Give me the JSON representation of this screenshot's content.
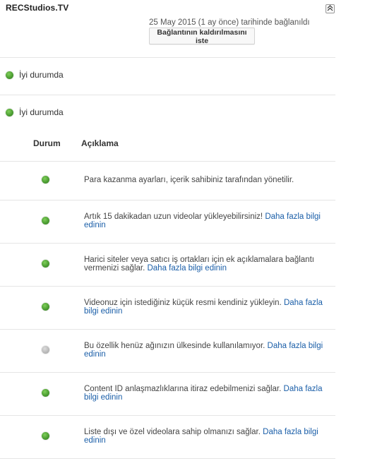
{
  "channel": {
    "name": "RECStudios.TV",
    "linked_text": "25 May 2015 (1 ay önce) tarihinde bağlanıldı",
    "unlink_button": "Bağlantının kaldırılmasını iste",
    "collapse_symbol": "⌃"
  },
  "status_summary": [
    {
      "label": "İyi durumda",
      "color": "#4d9e33"
    },
    {
      "label": "İyi durumda",
      "color": "#4d9e33"
    }
  ],
  "table": {
    "headers": {
      "status": "Durum",
      "description": "Açıklama"
    },
    "rows": [
      {
        "status": "green",
        "text": "Para kazanma ayarları, içerik sahibiniz tarafından yönetilir.",
        "link": ""
      },
      {
        "status": "green",
        "text": "Artık 15 dakikadan uzun videolar yükleyebilirsiniz! ",
        "link": "Daha fazla bilgi edinin"
      },
      {
        "status": "green",
        "text": "Harici siteler veya satıcı iş ortakları için ek açıklamalara bağlantı vermenizi sağlar. ",
        "link": "Daha fazla bilgi edinin"
      },
      {
        "status": "green",
        "text": "Videonuz için istediğiniz küçük resmi kendiniz yükleyin. ",
        "link": "Daha fazla bilgi edinin"
      },
      {
        "status": "gray",
        "text": "Bu özellik henüz ağınızın ülkesinde kullanılamıyor. ",
        "link": "Daha fazla bilgi edinin"
      },
      {
        "status": "green",
        "text": "Content ID anlaşmazlıklarına itiraz edebilmenizi sağlar. ",
        "link": "Daha fazla bilgi edinin"
      },
      {
        "status": "green",
        "text": "Liste dışı ve özel videolara sahip olmanızı sağlar. ",
        "link": "Daha fazla bilgi edinin"
      }
    ]
  },
  "colors": {
    "link": "#1a5ea8",
    "green": "#4d9e33",
    "gray": "#b8b8b8"
  }
}
